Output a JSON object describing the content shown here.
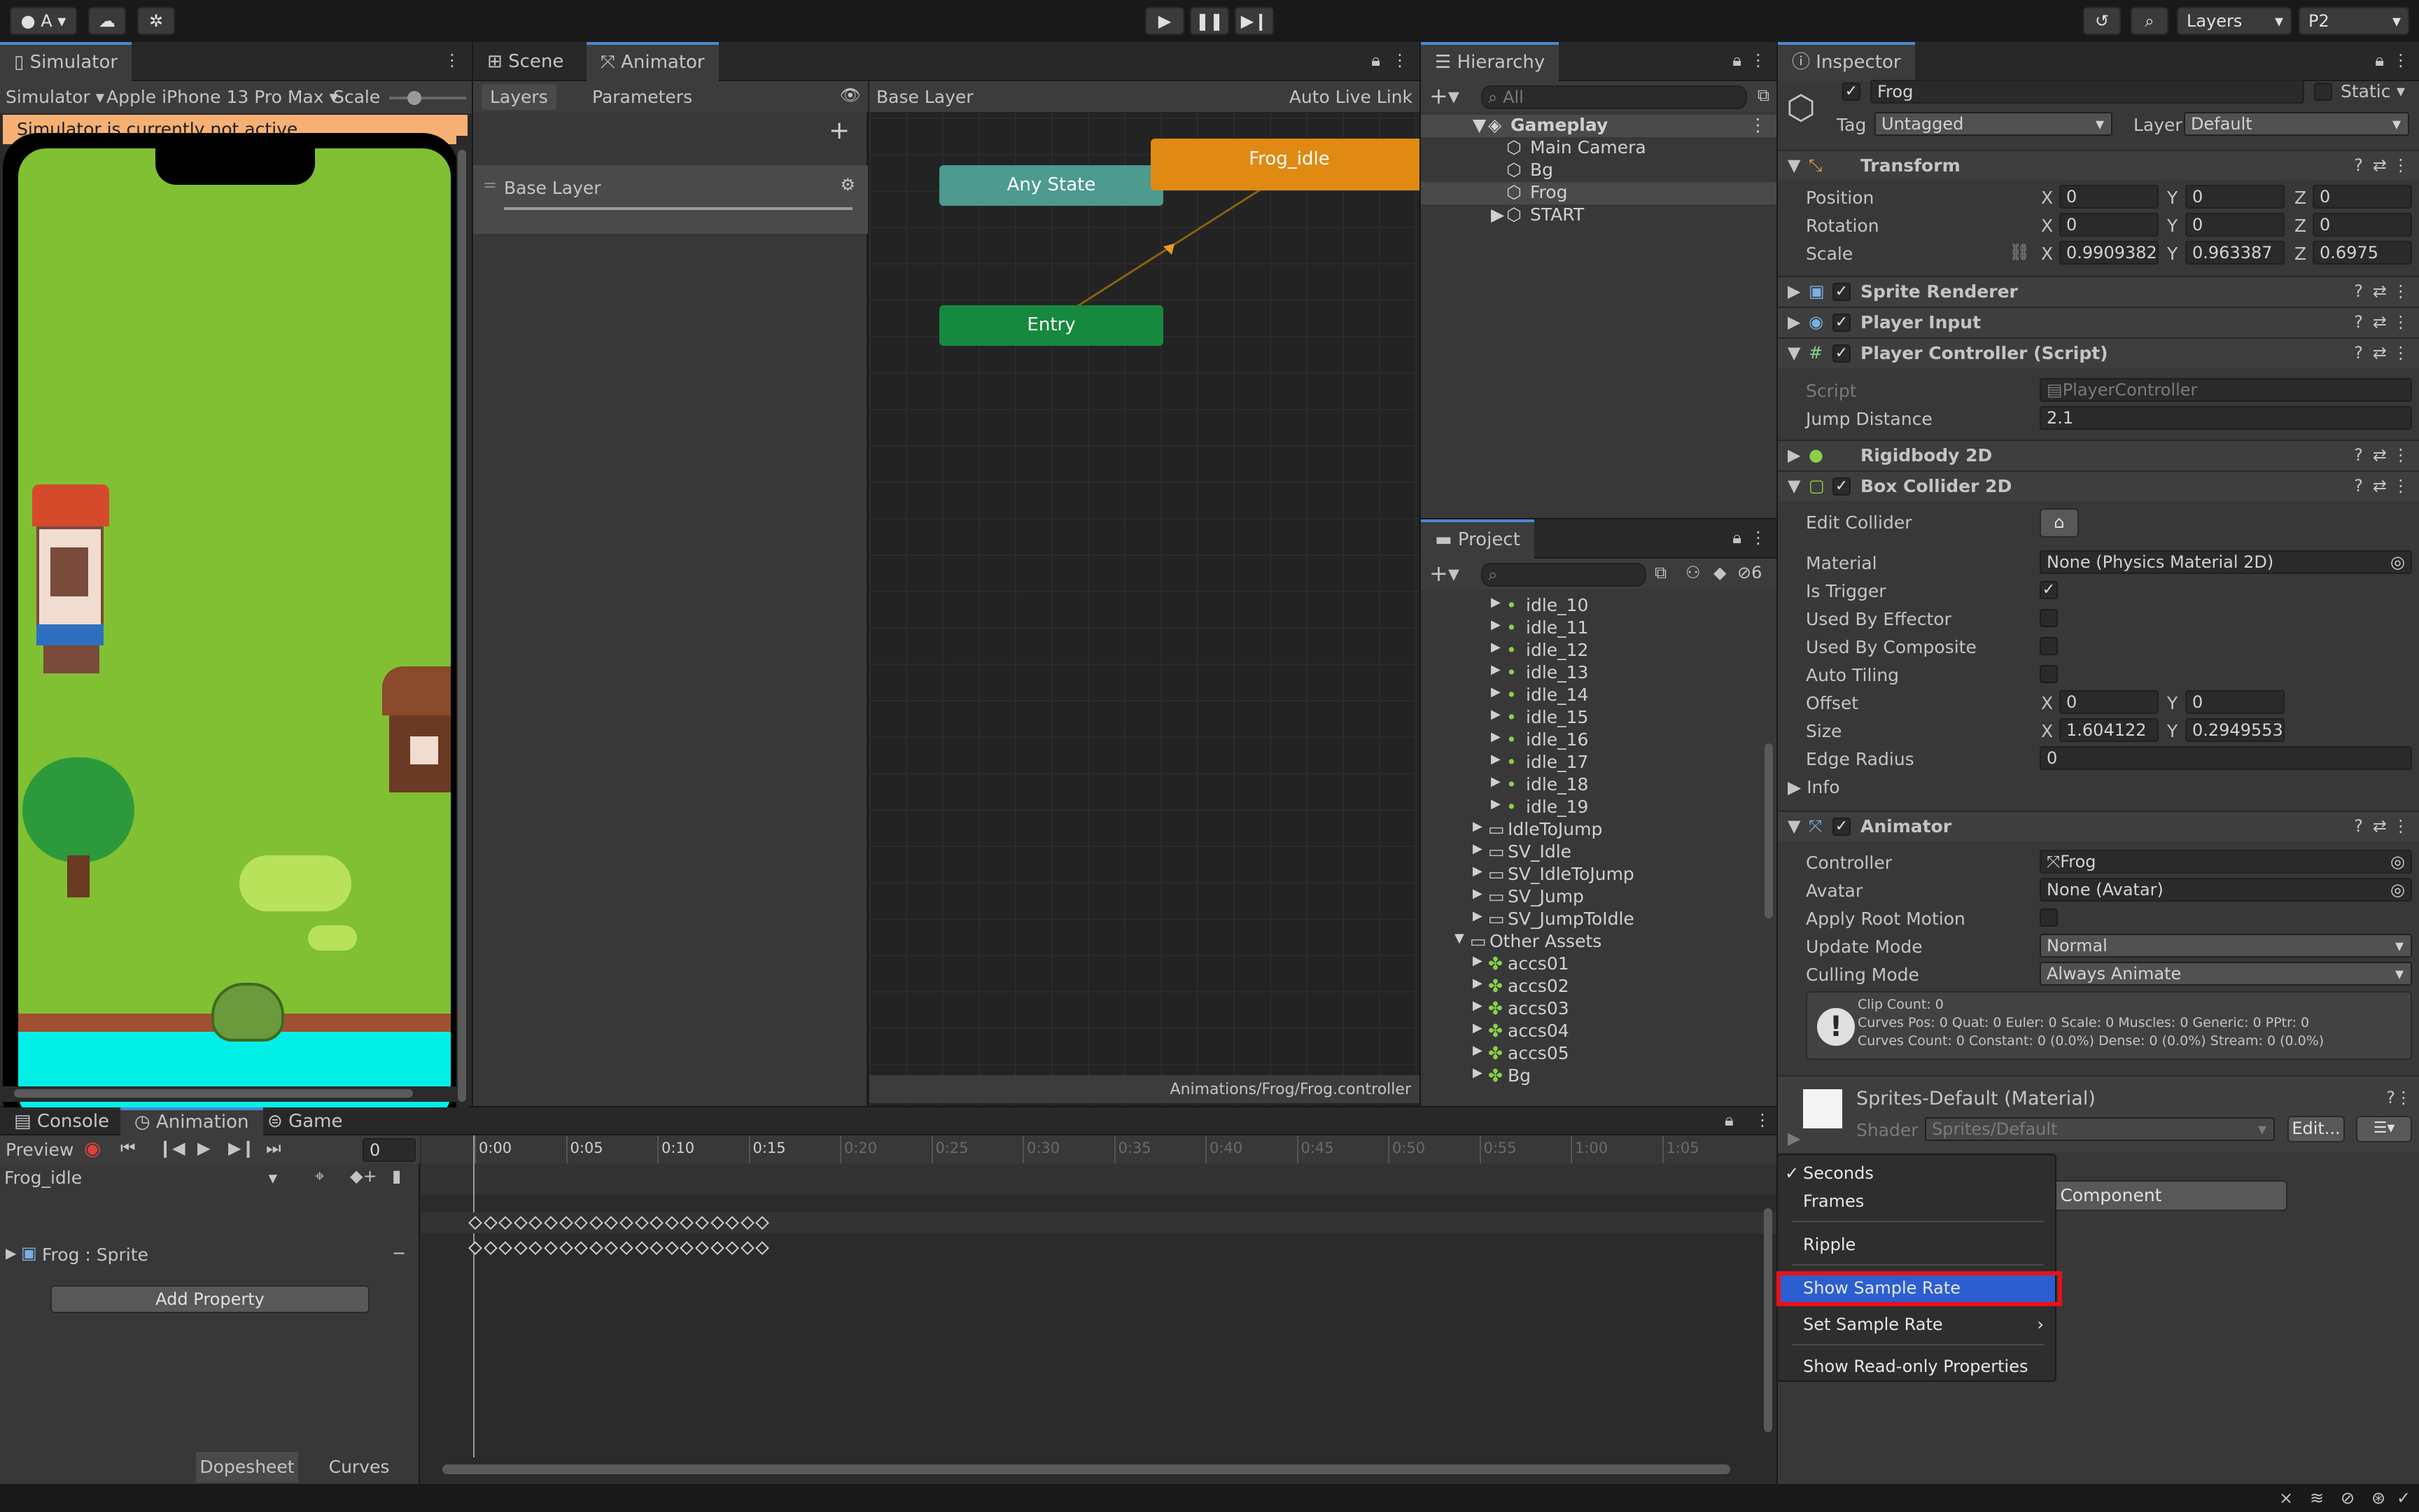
{
  "toolbar": {
    "account_label": "A",
    "layers_label": "Layers",
    "layout_label": "P2"
  },
  "simulator": {
    "tab": "Simulator",
    "mode": "Simulator",
    "device": "Apple iPhone 13 Pro Max",
    "scale_label": "Scale",
    "warning": "Simulator is currently not active."
  },
  "animator": {
    "tab_scene": "Scene",
    "tab_animator": "Animator",
    "layers_tab": "Layers",
    "parameters_tab": "Parameters",
    "breadcrumb": "Base Layer",
    "auto_live_link": "Auto Live Link",
    "layer_name": "Base Layer",
    "states": {
      "any_state": "Any State",
      "entry": "Entry",
      "frog_idle": "Frog_idle"
    },
    "path": "Animations/Frog/Frog.controller"
  },
  "hierarchy": {
    "tab": "Hierarchy",
    "search_placeholder": "All",
    "root": "Gameplay",
    "items": [
      "Main Camera",
      "Bg",
      "Frog",
      "START"
    ]
  },
  "project": {
    "tab": "Project",
    "hidden_count": "6",
    "items": [
      {
        "label": "idle_10",
        "depth": 2,
        "kind": "sprite"
      },
      {
        "label": "idle_11",
        "depth": 2,
        "kind": "sprite"
      },
      {
        "label": "idle_12",
        "depth": 2,
        "kind": "sprite"
      },
      {
        "label": "idle_13",
        "depth": 2,
        "kind": "sprite"
      },
      {
        "label": "idle_14",
        "depth": 2,
        "kind": "sprite"
      },
      {
        "label": "idle_15",
        "depth": 2,
        "kind": "sprite"
      },
      {
        "label": "idle_16",
        "depth": 2,
        "kind": "sprite"
      },
      {
        "label": "idle_17",
        "depth": 2,
        "kind": "sprite"
      },
      {
        "label": "idle_18",
        "depth": 2,
        "kind": "sprite"
      },
      {
        "label": "idle_19",
        "depth": 2,
        "kind": "sprite"
      },
      {
        "label": "IdleToJump",
        "depth": 1,
        "kind": "folder"
      },
      {
        "label": "SV_Idle",
        "depth": 1,
        "kind": "folder"
      },
      {
        "label": "SV_IdleToJump",
        "depth": 1,
        "kind": "folder"
      },
      {
        "label": "SV_Jump",
        "depth": 1,
        "kind": "folder"
      },
      {
        "label": "SV_JumpToIdle",
        "depth": 1,
        "kind": "folder"
      },
      {
        "label": "Other Assets",
        "depth": 0,
        "kind": "folder-open"
      },
      {
        "label": "accs01",
        "depth": 1,
        "kind": "asset"
      },
      {
        "label": "accs02",
        "depth": 1,
        "kind": "asset"
      },
      {
        "label": "accs03",
        "depth": 1,
        "kind": "asset"
      },
      {
        "label": "accs04",
        "depth": 1,
        "kind": "asset"
      },
      {
        "label": "accs05",
        "depth": 1,
        "kind": "asset"
      },
      {
        "label": "Bg",
        "depth": 1,
        "kind": "asset"
      }
    ]
  },
  "inspector": {
    "tab": "Inspector",
    "object_name": "Frog",
    "static_label": "Static",
    "tag_label": "Tag",
    "tag_value": "Untagged",
    "layer_label": "Layer",
    "layer_value": "Default",
    "transform": {
      "title": "Transform",
      "position_label": "Position",
      "pos_x": "0",
      "pos_y": "0",
      "pos_z": "0",
      "rotation_label": "Rotation",
      "rot_x": "0",
      "rot_y": "0",
      "rot_z": "0",
      "scale_label": "Scale",
      "scale_x": "0.9909382",
      "scale_y": "0.963387",
      "scale_z": "0.6975"
    },
    "sprite_renderer": "Sprite Renderer",
    "player_input": "Player Input",
    "player_controller": {
      "title": "Player Controller (Script)",
      "script_label": "Script",
      "script_value": "PlayerController",
      "jump_label": "Jump Distance",
      "jump_value": "2.1"
    },
    "rigidbody": "Rigidbody 2D",
    "box_collider": {
      "title": "Box Collider 2D",
      "edit_collider": "Edit Collider",
      "material_label": "Material",
      "material_value": "None (Physics Material 2D)",
      "is_trigger": "Is Trigger",
      "used_by_effector": "Used By Effector",
      "used_by_composite": "Used By Composite",
      "auto_tiling": "Auto Tiling",
      "offset_label": "Offset",
      "offset_x": "0",
      "offset_y": "0",
      "size_label": "Size",
      "size_x": "1.604122",
      "size_y": "0.2949553",
      "edge_radius_label": "Edge Radius",
      "edge_radius_value": "0",
      "info": "Info"
    },
    "animator": {
      "title": "Animator",
      "controller_label": "Controller",
      "controller_value": "Frog",
      "avatar_label": "Avatar",
      "avatar_value": "None (Avatar)",
      "apply_root_motion": "Apply Root Motion",
      "update_mode_label": "Update Mode",
      "update_mode_value": "Normal",
      "culling_mode_label": "Culling Mode",
      "culling_mode_value": "Always Animate",
      "info_line1": "Clip Count: 0",
      "info_line2": "Curves Pos: 0 Quat: 0 Euler: 0 Scale: 0 Muscles: 0 Generic: 0 PPtr: 0",
      "info_line3": "Curves Count: 0 Constant: 0 (0.0%) Dense: 0 (0.0%) Stream: 0 (0.0%)"
    },
    "material": {
      "title": "Sprites-Default (Material)",
      "shader_label": "Shader",
      "shader_value": "Sprites/Default",
      "edit": "Edit..."
    },
    "add_component": "Add Component",
    "add_component_visible": "d Component"
  },
  "animation": {
    "tab_console": "Console",
    "tab_animation": "Animation",
    "tab_game": "Game",
    "preview": "Preview",
    "frame": "0",
    "clip": "Frog_idle",
    "property": "Frog : Sprite",
    "add_property": "Add Property",
    "dopesheet": "Dopesheet",
    "curves": "Curves",
    "ticks": [
      "0:00",
      "0:05",
      "0:10",
      "0:15",
      "0:20",
      "0:25",
      "0:30",
      "0:35",
      "0:40",
      "0:45",
      "0:50",
      "0:55",
      "1:00",
      "1:05"
    ]
  },
  "context_menu": {
    "items": [
      {
        "label": "Seconds",
        "checked": true
      },
      {
        "label": "Frames",
        "checked": false
      },
      {
        "label": "Ripple",
        "checked": false
      },
      {
        "label": "Show Sample Rate",
        "checked": false,
        "highlighted": true
      },
      {
        "label": "Set Sample Rate",
        "submenu": true
      },
      {
        "label": "Show Read-only Properties",
        "checked": false
      }
    ]
  },
  "colors": {
    "accent": "#4a88d0",
    "highlight": "#2c5ecf",
    "annotation": "#e8101a",
    "entry": "#16893f",
    "any_state": "#4c9a90",
    "default_state": "#e08a14",
    "warning_bg": "#f6b073"
  }
}
